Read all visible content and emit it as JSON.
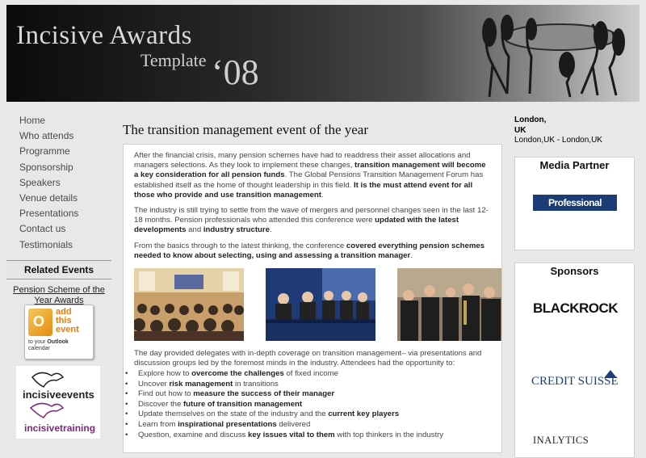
{
  "banner": {
    "title": "Incisive Awards",
    "subtitle": "Template",
    "year": "‘08"
  },
  "nav": [
    {
      "label": "Home"
    },
    {
      "label": "Who attends"
    },
    {
      "label": "Programme"
    },
    {
      "label": "Sponsorship"
    },
    {
      "label": "Speakers"
    },
    {
      "label": "Venue details"
    },
    {
      "label": "Presentations"
    },
    {
      "label": "Contact us"
    },
    {
      "label": "Testimonials"
    }
  ],
  "related": {
    "heading": "Related Events",
    "link": "Pension Scheme of the Year Awards",
    "outlook": {
      "icon_letter": "O",
      "add_line1": "add",
      "add_line2": "this",
      "add_line3": "event",
      "foot_pre": "to your ",
      "foot_bold": "Outlook",
      "foot_post": "calendar"
    },
    "logo1": "incisiveevents",
    "logo2": "incisivetraining"
  },
  "main": {
    "heading": "The transition management event of the year",
    "p1": {
      "a": "After the financial crisis, many pension schemes have had to readdress their asset allocations and managers selections. As they look to implement these changes, ",
      "b": "transition management will become a key consideration for all pension funds",
      "c": ". The Global Pensions Transition Management Forum has established itself as the home of thought leadership in this field. ",
      "d": "It is the must attend event for all those who provide and use transition management",
      "e": "."
    },
    "p2": {
      "a": "The industry is still trying to settle from the wave of mergers and personnel changes seen in the last 12-18 months. Pension professionals who attended this conference were ",
      "b": "updated with the latest developments",
      "c": " and ",
      "d": "industry structure",
      "e": "."
    },
    "p3": {
      "a": "From the basics through to the latest thinking, the conference ",
      "b": "covered everything pension schemes needed to know about selecting, using and assessing a transition manager",
      "c": "."
    },
    "p4": "The day provided delegates with in-depth coverage on transition management– via presentations and discussion groups led by the foremost minds in the industry. Attendees had the opportunity to:",
    "bullets": [
      {
        "pre": "Explore how to ",
        "bold": "overcome the challenges",
        "post": " of fixed income"
      },
      {
        "pre": "Uncover ",
        "bold": "risk management",
        "post": " in transitions"
      },
      {
        "pre": "Find out how to ",
        "bold": "measure the success of their manager",
        "post": ""
      },
      {
        "pre": "Discover the ",
        "bold": "future of transition management",
        "post": ""
      },
      {
        "pre": "Update themselves on the state of the industry and the ",
        "bold": "current key players",
        "post": ""
      },
      {
        "pre": "Learn from ",
        "bold": "inspirational presentations",
        "post": " delivered"
      },
      {
        "pre": "Question, examine and discuss ",
        "bold": "key issues vital to them",
        "post": " with top thinkers in the industry"
      }
    ]
  },
  "location": {
    "city": "London,",
    "country": "UK",
    "full": "London,UK - London,UK"
  },
  "media_partner": {
    "heading": "Media Partner",
    "logo": "Professional Pensions"
  },
  "sponsors": {
    "heading": "Sponsors",
    "items": [
      "BLACKROCK",
      "CREDIT SUISSE",
      "INALYTICS"
    ]
  }
}
